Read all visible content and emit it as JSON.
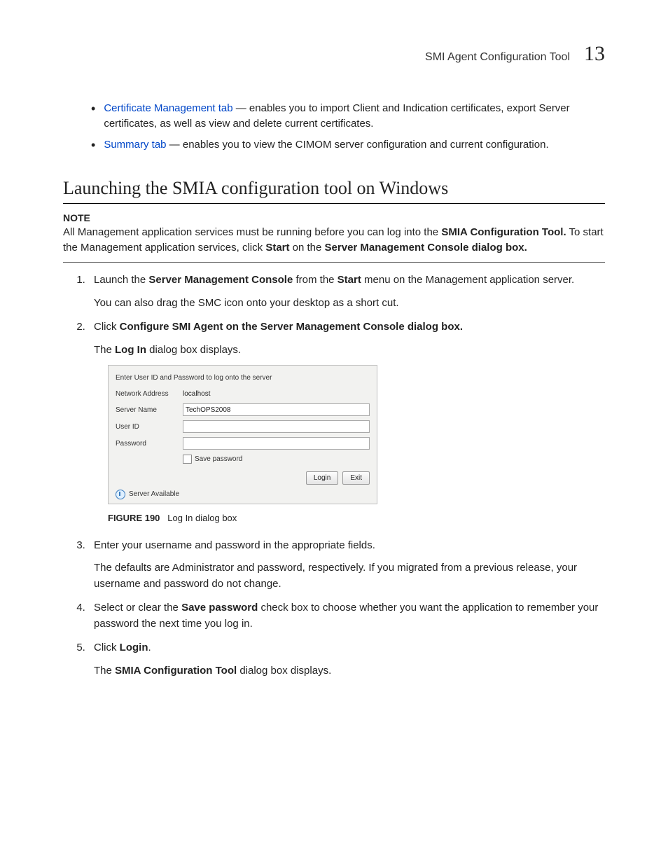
{
  "header": {
    "title": "SMI Agent Configuration Tool",
    "chapter": "13"
  },
  "bullets": [
    {
      "link": "Certificate Management tab",
      "text": " — enables you to import Client and Indication certificates, export Server certificates, as well as view and delete current certificates."
    },
    {
      "link": "Summary tab",
      "text": " — enables you to view the CIMOM server configuration and current configuration."
    }
  ],
  "section_title": "Launching the SMIA configuration tool on Windows",
  "note_label": "NOTE",
  "note_parts": {
    "p1": "All Management application services must be running before you can log into the ",
    "b1": "SMIA Configuration Tool.",
    "p2": " To start the Management application services, click ",
    "b2": "Start",
    "p3": " on the ",
    "b3": "Server Management Console dialog box."
  },
  "step1": {
    "p1": "Launch the ",
    "b1": "Server Management Console",
    "p2": " from the ",
    "b2": "Start",
    "p3": " menu on the Management application server.",
    "sub": "You can also drag the SMC icon onto your desktop as a short cut."
  },
  "step2": {
    "p1": "Click ",
    "b1": "Configure SMI Agent on the Server Management Console dialog box.",
    "sub_p1": "The ",
    "sub_b1": "Log In",
    "sub_p2": " dialog box displays."
  },
  "dialog": {
    "instruction": "Enter User ID and Password to log onto the server",
    "net_label": "Network Address",
    "net_value": "localhost",
    "srv_label": "Server Name",
    "srv_value": "TechOPS2008",
    "uid_label": "User ID",
    "pwd_label": "Password",
    "save_label": "Save password",
    "login_btn": "Login",
    "exit_btn": "Exit",
    "status": "Server Available"
  },
  "figure": {
    "label": "FIGURE 190",
    "caption": "Log In dialog box"
  },
  "step3": {
    "p1": "Enter your username and password in the appropriate fields.",
    "sub": "The defaults are Administrator and password, respectively. If you migrated from a previous release, your username and password do not change."
  },
  "step4": {
    "p1": "Select or clear the ",
    "b1": "Save password",
    "p2": " check box to choose whether you want the application to remember your password the next time you log in."
  },
  "step5": {
    "p1": "Click ",
    "b1": "Login",
    "p2": ".",
    "sub_p1": "The ",
    "sub_b1": "SMIA Configuration Tool",
    "sub_p2": " dialog box displays."
  }
}
